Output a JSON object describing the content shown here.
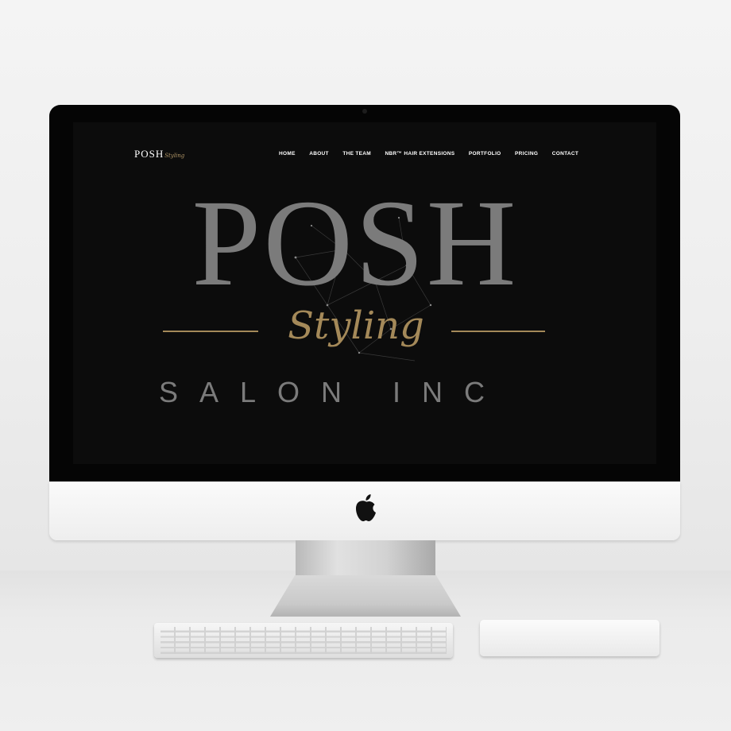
{
  "site": {
    "logo_word": "POSH",
    "logo_script": "Styling"
  },
  "nav": {
    "items": [
      "HOME",
      "ABOUT",
      "THE TEAM",
      "NBR™ HAIR EXTENSIONS",
      "PORTFOLIO",
      "PRICING",
      "CONTACT"
    ]
  },
  "hero": {
    "title": "POSH",
    "script": "Styling",
    "subtitle": "SALON INC"
  },
  "colors": {
    "background": "#0c0c0c",
    "title_gray": "#7b7b7b",
    "accent_gold": "#a48959",
    "nav_text": "#ffffff"
  },
  "icons": {
    "chin_logo": "apple-logo-icon"
  }
}
